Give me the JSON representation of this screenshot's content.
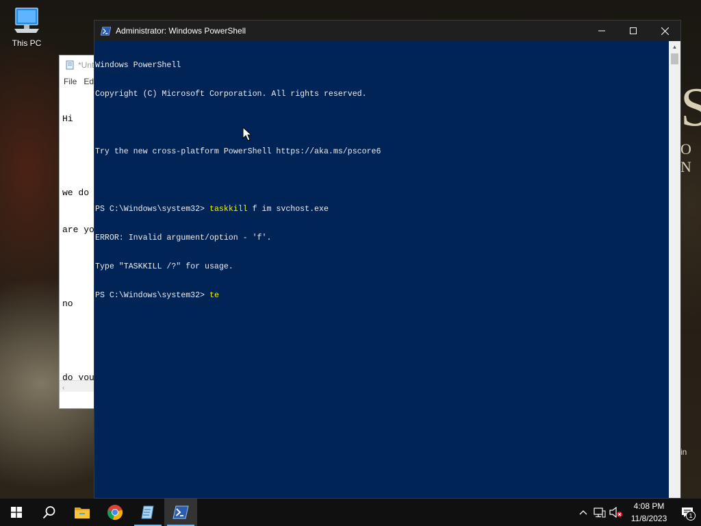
{
  "desktop": {
    "icons": [
      {
        "label": "This PC",
        "icon": "this-pc-icon"
      }
    ],
    "bg_text": {
      "s": "S",
      "on": "O N",
      "in": "in"
    }
  },
  "notepad": {
    "title": "*Unt",
    "menu": [
      "File",
      "Ed"
    ],
    "lines": [
      "Hi",
      "",
      "we do",
      "are yo",
      "",
      "no",
      "",
      "do you"
    ]
  },
  "powershell": {
    "title": "Administrator: Windows PowerShell",
    "lines": [
      {
        "text": "Windows PowerShell"
      },
      {
        "text": "Copyright (C) Microsoft Corporation. All rights reserved."
      },
      {
        "text": ""
      },
      {
        "text": "Try the new cross-platform PowerShell https://aka.ms/pscore6"
      },
      {
        "text": ""
      },
      {
        "prompt": "PS C:\\Windows\\system32> ",
        "cmd": "taskkill",
        "rest": " f im svchost.exe"
      },
      {
        "text": "ERROR: Invalid argument/option - 'f'."
      },
      {
        "text": "Type \"TASKKILL /?\" for usage."
      },
      {
        "prompt": "PS C:\\Windows\\system32> ",
        "cmd": "te",
        "rest": ""
      }
    ]
  },
  "taskbar": {
    "apps": [
      {
        "name": "start",
        "icon": "windows-start-icon"
      },
      {
        "name": "search",
        "icon": "search-icon"
      },
      {
        "name": "file-explorer",
        "icon": "folder-icon"
      },
      {
        "name": "chrome",
        "icon": "chrome-icon"
      },
      {
        "name": "notepad",
        "icon": "notepad-icon"
      },
      {
        "name": "powershell",
        "icon": "powershell-icon",
        "active": true
      }
    ],
    "clock": {
      "time": "4:08 PM",
      "date": "11/8/2023"
    },
    "notification_count": "1"
  }
}
